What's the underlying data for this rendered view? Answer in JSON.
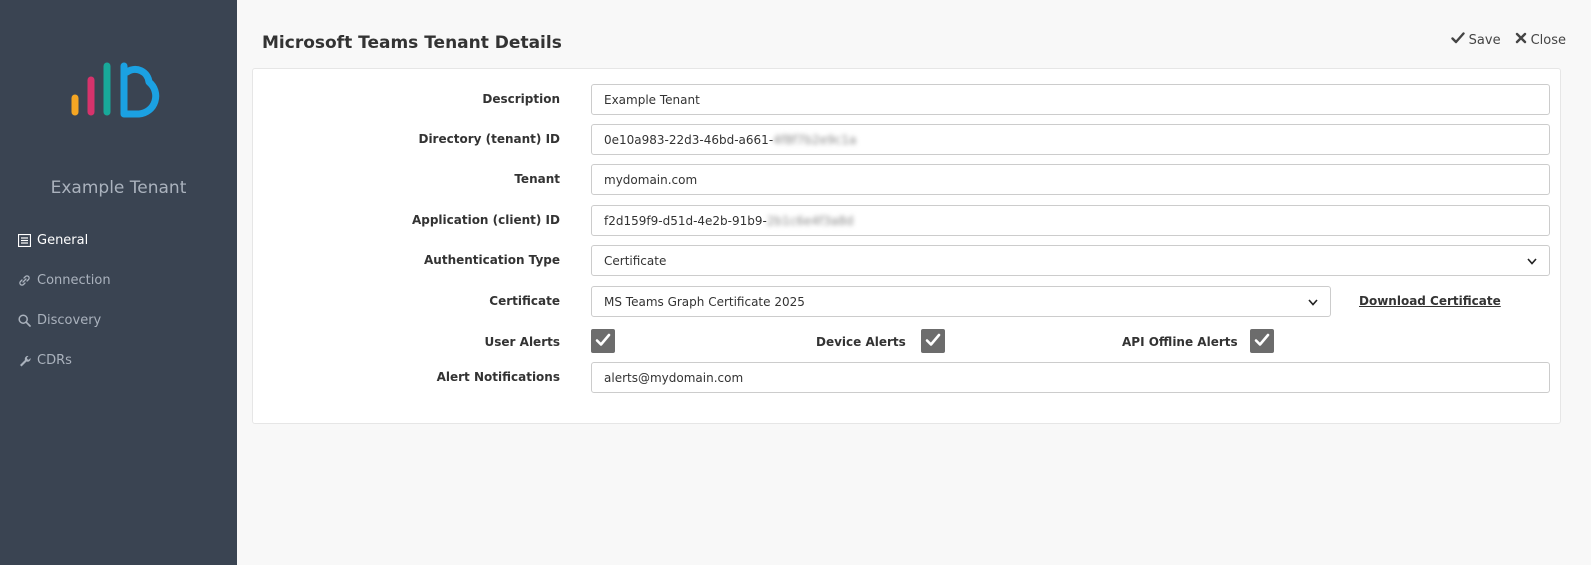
{
  "sidebar": {
    "tenant_name": "Example Tenant",
    "items": [
      {
        "label": "General",
        "icon": "list-icon",
        "active": true
      },
      {
        "label": "Connection",
        "icon": "link-icon",
        "active": false
      },
      {
        "label": "Discovery",
        "icon": "search-icon",
        "active": false
      },
      {
        "label": "CDRs",
        "icon": "wrench-icon",
        "active": false
      }
    ]
  },
  "header": {
    "title": "Microsoft Teams Tenant Details",
    "save_label": "Save",
    "close_label": "Close"
  },
  "form": {
    "description": {
      "label": "Description",
      "value": "Example Tenant"
    },
    "directory_id": {
      "label": "Directory (tenant) ID",
      "value": "0e10a983-22d3-46bd-a661-",
      "value_obscured": "4f8f7b2e9c1a"
    },
    "tenant": {
      "label": "Tenant",
      "value": "mydomain.com"
    },
    "application_id": {
      "label": "Application (client) ID",
      "value": "f2d159f9-d51d-4e2b-91b9-",
      "value_obscured": "2b1c6e4f3a8d"
    },
    "auth_type": {
      "label": "Authentication Type",
      "value": "Certificate"
    },
    "certificate": {
      "label": "Certificate",
      "value": "MS Teams Graph Certificate 2025",
      "download_label": "Download Certificate"
    },
    "user_alerts": {
      "label": "User Alerts",
      "checked": true
    },
    "device_alerts": {
      "label": "Device Alerts",
      "checked": true
    },
    "api_offline_alerts": {
      "label": "API Offline Alerts",
      "checked": true
    },
    "alert_notifications": {
      "label": "Alert Notifications",
      "value": "alerts@mydomain.com"
    }
  },
  "colors": {
    "sidebar_bg": "#3a4452",
    "logo_orange": "#f5a623",
    "logo_pink": "#d6336c",
    "logo_teal": "#18a999",
    "logo_blue": "#1ba1e2"
  }
}
